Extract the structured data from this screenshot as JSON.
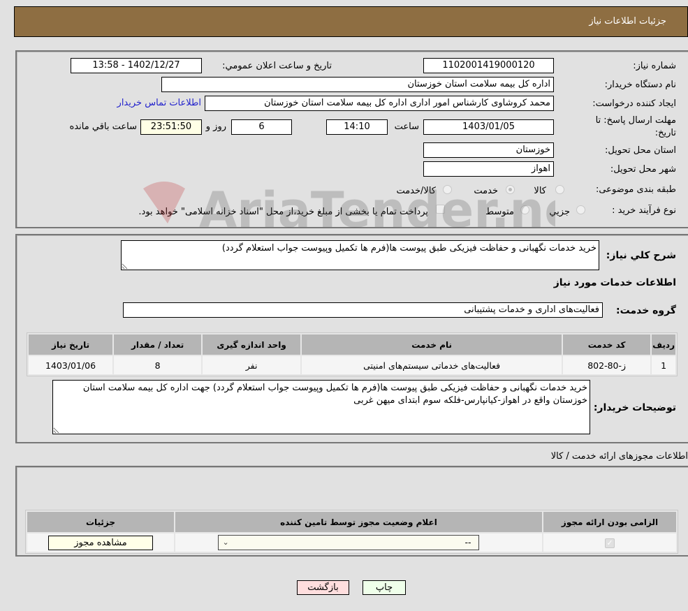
{
  "header": {
    "title": "جزئیات اطلاعات نیاز"
  },
  "details": {
    "need_number_label": "شماره نیاز:",
    "need_number": "1102001419000120",
    "announce_label": "تاريخ و ساعت اعلان عمومي:",
    "announce_value": "1402/12/27 - 13:58",
    "buyer_org_label": "نام دستگاه خريدار:",
    "buyer_org": "اداره کل بیمه سلامت استان خوزستان",
    "creator_label": "ايجاد کننده درخواست:",
    "creator": "محمد کروشاوی کارشناس امور اداری اداره کل بیمه سلامت استان خوزستان",
    "contact_link": "اطلاعات تماس خريدار",
    "deadline_label": "مهلت ارسال پاسخ: تا تاريخ:",
    "deadline_date": "1403/01/05",
    "time_label": "ساعت",
    "deadline_time": "14:10",
    "days_value": "6",
    "days_label": "روز و",
    "remaining_time": "23:51:50",
    "remaining_label": "ساعت باقي مانده",
    "province_label": "استان محل تحويل:",
    "province": "خوزستان",
    "city_label": "شهر محل تحويل:",
    "city": "اهواز",
    "category_label": "طبقه بندی موضوعی:",
    "category_options": [
      "کالا",
      "خدمت",
      "کالا/خدمت"
    ],
    "category_selected": "خدمت",
    "process_label": "نوع فرآيند خريد :",
    "process_options": [
      "جزيي",
      "متوسط"
    ],
    "treasury_note": "پرداخت تمام يا بخشی از مبلغ خريد،از محل \"اسناد خزانه اسلامی\" خواهد بود."
  },
  "description": {
    "label": "شرح کلي نياز:",
    "value": "خرید خدمات نگهبانی و حفاظت فیزیکی طبق پیوست ها(فرم ها تکمیل وپیوست جواب استعلام گردد)",
    "services_heading": "اطلاعات خدمات مورد نياز",
    "group_label": "گروه خدمت:",
    "group_value": "فعالیت‌های اداری و خدمات پشتیبانی"
  },
  "services_table": {
    "headers": [
      "رديف",
      "کد خدمت",
      "نام خدمت",
      "واحد اندازه گيری",
      "تعداد / مقدار",
      "تاريخ نياز"
    ],
    "rows": [
      [
        "1",
        "ز-80-802",
        "فعالیت‌های خدماتی سیستم‌های امنیتی",
        "نفر",
        "8",
        "1403/01/06"
      ]
    ]
  },
  "buyer_notes": {
    "label": "توضيحات خريدار:",
    "value": "خرید خدمات نگهبانی و حفاظت فیزیکی طبق پیوست ها(فرم ها تکمیل وپیوست جواب استعلام گردد) جهت اداره کل بیمه سلامت استان خوزستان واقع در اهواز-کیانپارس-فلکه سوم ابتدای میهن غربی"
  },
  "permits": {
    "title": "اطلاعات مجوزهای ارائه خدمت / کالا",
    "headers": [
      "الزامی بودن ارائه مجوز",
      "اعلام وضعيت مجوز توسط تامين کننده",
      "جزئيات"
    ],
    "row": {
      "required_checked": true,
      "status_selected": "--",
      "view_button": "مشاهده مجوز"
    }
  },
  "footer": {
    "print_button": "چاپ",
    "back_button": "بازگشت"
  },
  "watermark": {
    "text": "AriaTender.neT"
  }
}
